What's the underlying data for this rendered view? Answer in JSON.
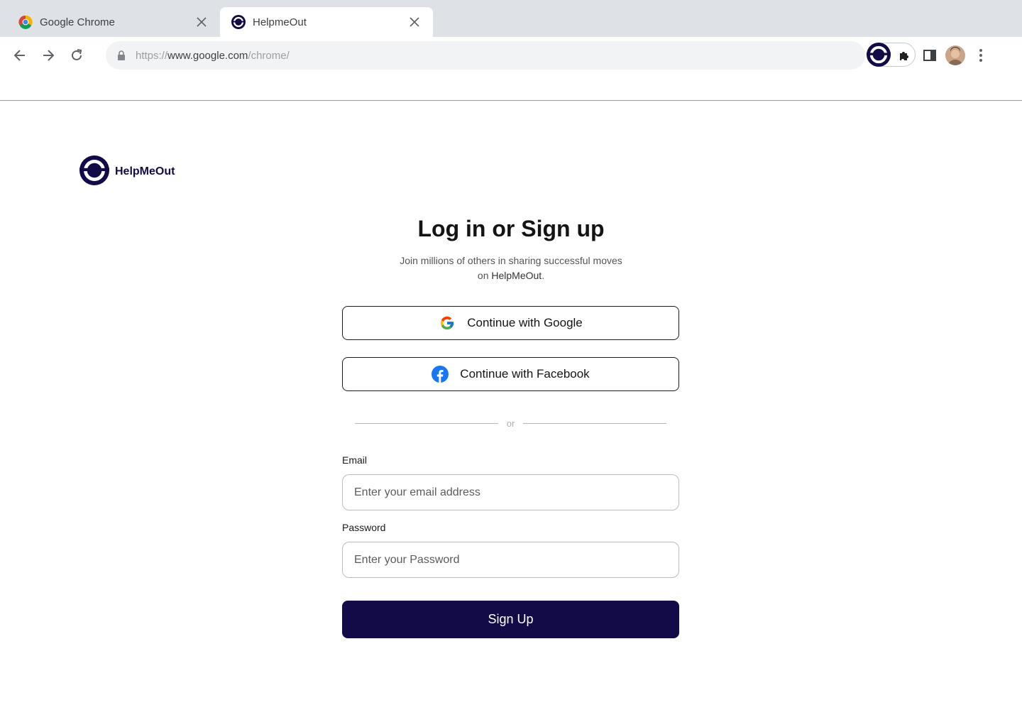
{
  "browser": {
    "tabs": [
      {
        "title": "Google Chrome",
        "active": false,
        "icon": "chrome-icon"
      },
      {
        "title": "HelpmeOut",
        "active": true,
        "icon": "helpmeout-icon"
      }
    ],
    "url": {
      "scheme": "https://",
      "host": "www.google.com",
      "path": "/chrome/"
    }
  },
  "page": {
    "brand_name": "HelpMeOut",
    "heading": "Log in or Sign up",
    "subtext_before": "Join millions of others in sharing successful moves on ",
    "subtext_brand": "HelpMeOut",
    "subtext_after": ".",
    "google_button": "Continue with Google",
    "facebook_button": "Continue with Facebook",
    "or_text": "or",
    "email_label": "Email",
    "email_placeholder": "Enter your email address",
    "password_label": "Password",
    "password_placeholder": "Enter your Password",
    "submit_label": "Sign Up"
  },
  "colors": {
    "brand": "#120b48",
    "tabstrip": "#dee1e6",
    "omnibox": "#f1f3f4"
  }
}
